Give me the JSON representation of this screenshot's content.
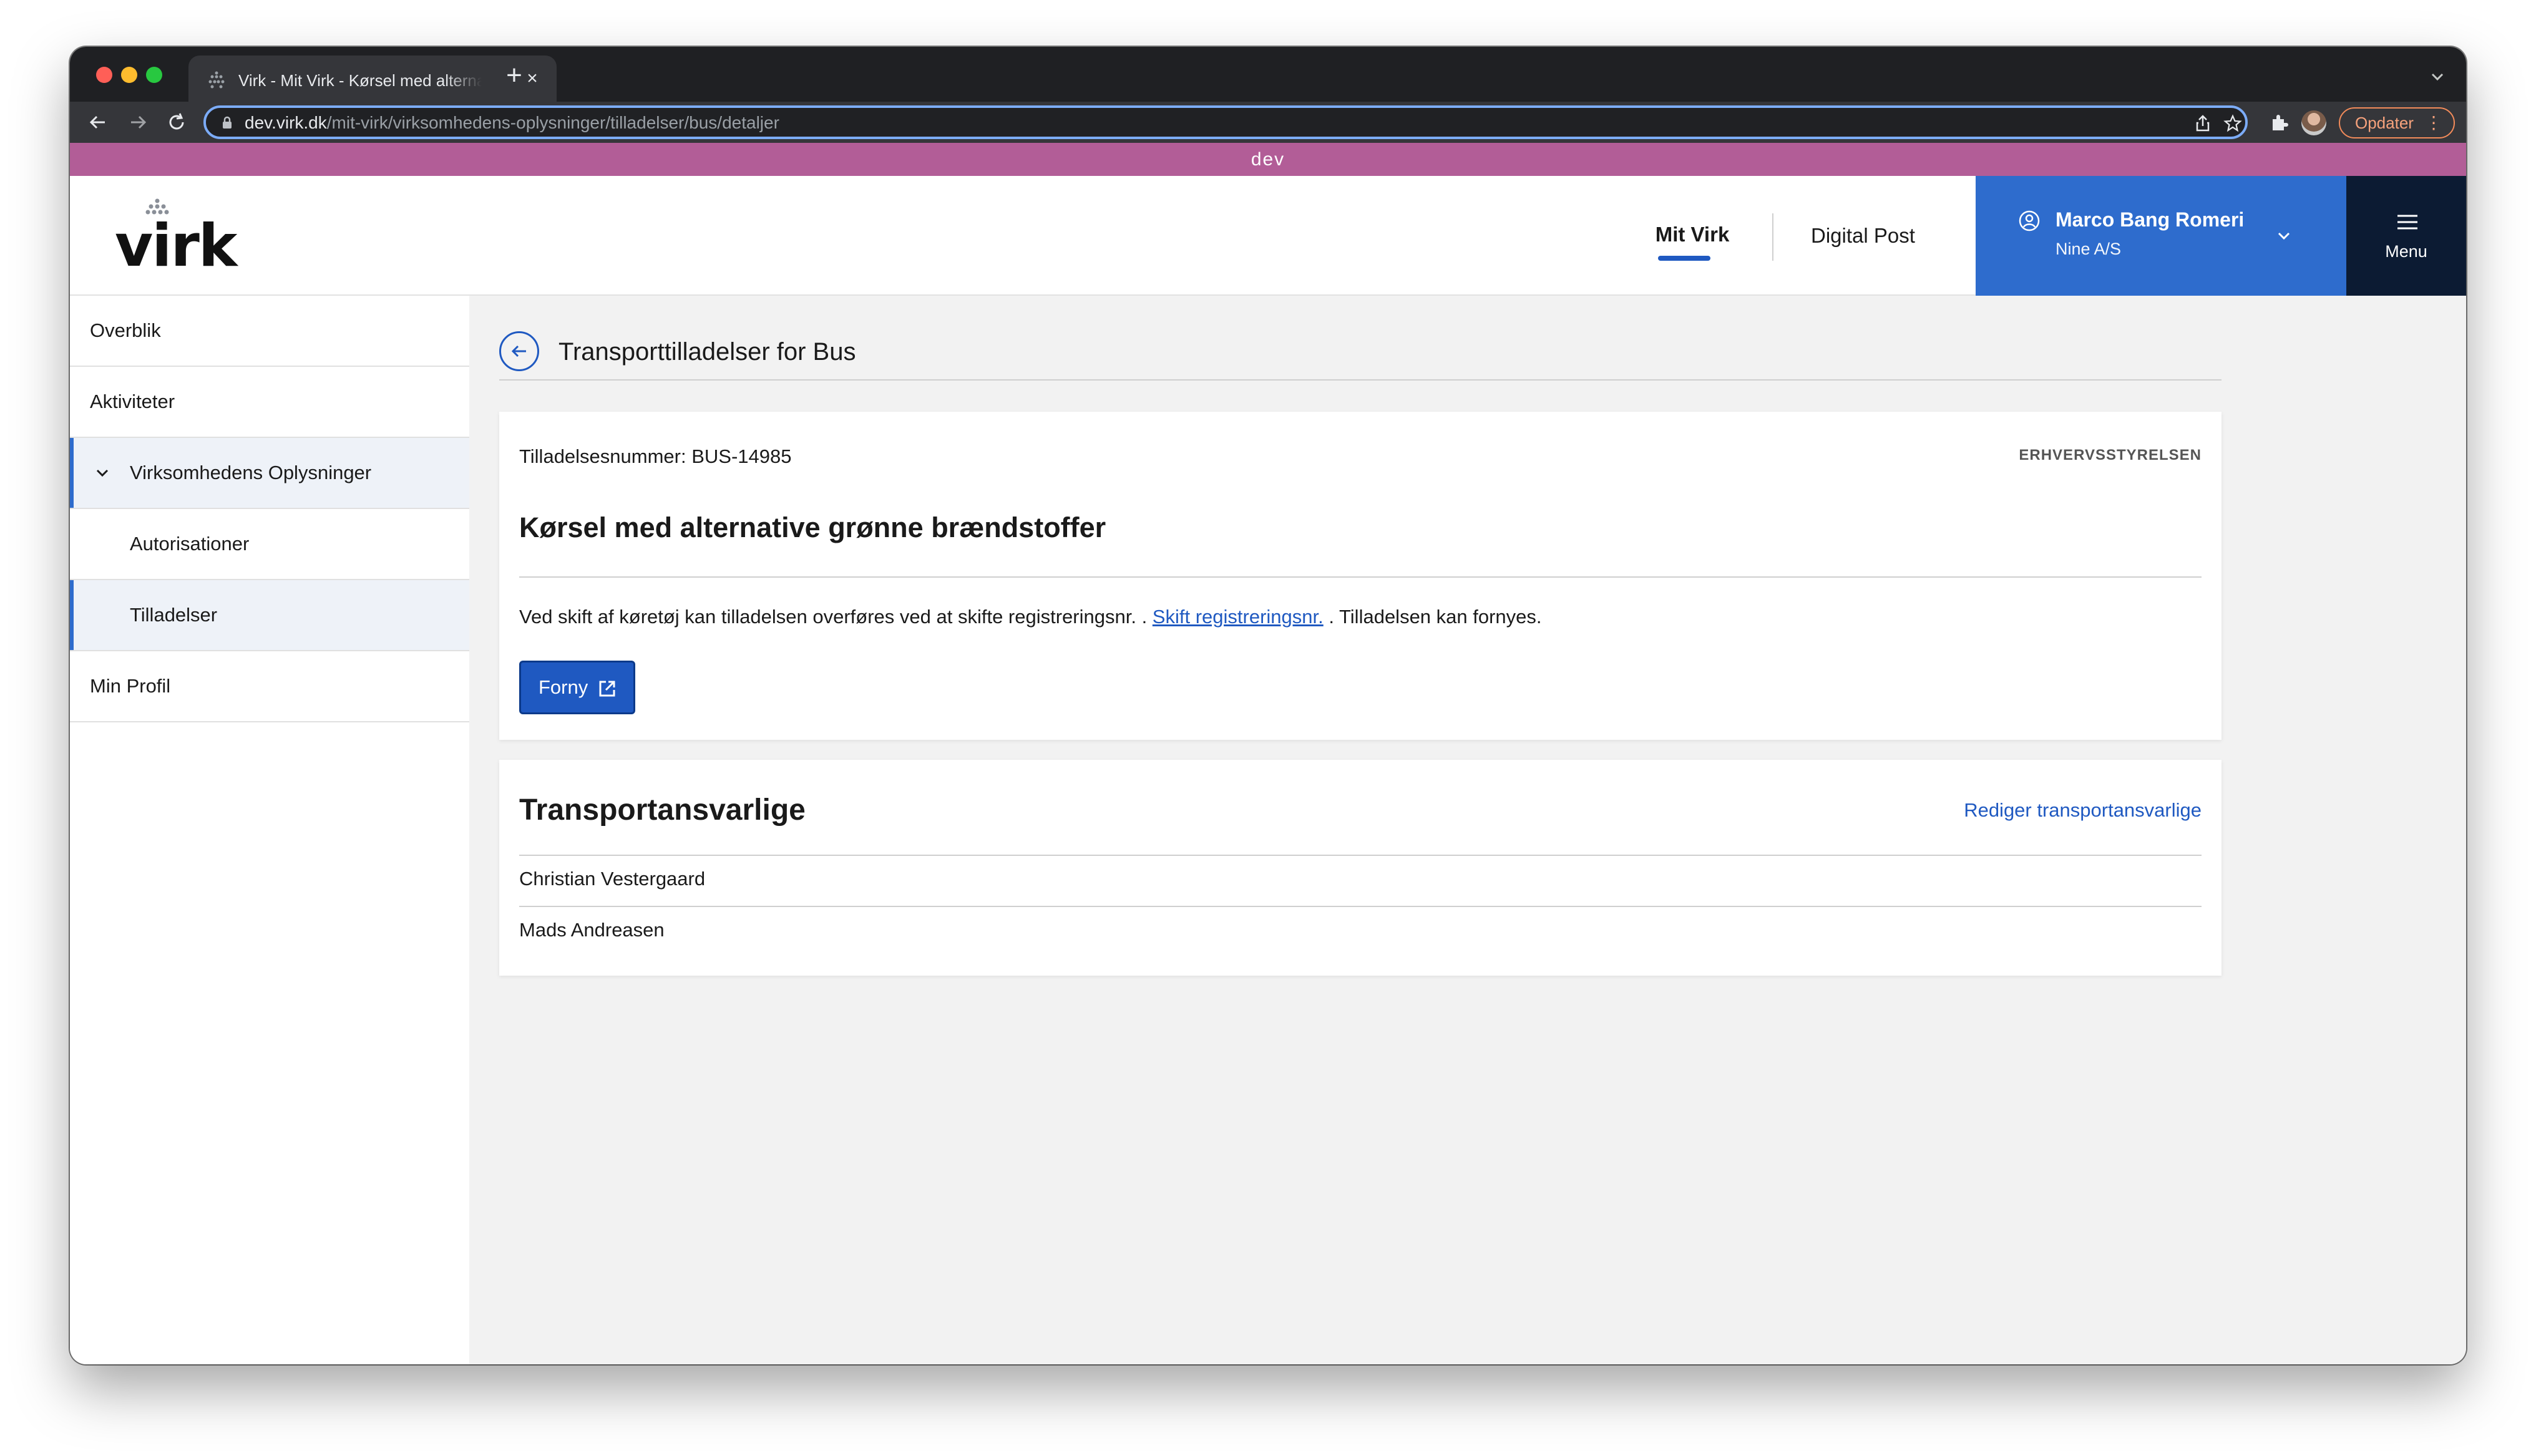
{
  "browser": {
    "tab_title": "Virk - Mit Virk - Kørsel med alternative grønne brændstoffer",
    "url_host": "dev.virk.dk",
    "url_path": "/mit-virk/virksomhedens-oplysninger/tilladelser/bus/detaljer",
    "update_label": "Opdater"
  },
  "env_banner": "dev",
  "header": {
    "logo_text": "virk",
    "nav": [
      {
        "label": "Mit Virk",
        "active": true
      },
      {
        "label": "Digital Post",
        "active": false
      }
    ],
    "user": {
      "name": "Marco Bang Romeri",
      "company": "Nine A/S"
    },
    "menu_label": "Menu"
  },
  "sidebar": {
    "items": [
      {
        "label": "Overblik"
      },
      {
        "label": "Aktiviteter"
      },
      {
        "label": "Virksomhedens Oplysninger",
        "expanded": true
      },
      {
        "label": "Autorisationer"
      },
      {
        "label": "Tilladelser",
        "active": true
      },
      {
        "label": "Min Profil"
      }
    ]
  },
  "main": {
    "page_title": "Transporttilladelser for Bus",
    "permit": {
      "number_label": "Tilladelsesnummer: BUS-14985",
      "authority": "ERHVERVSSTYRELSEN",
      "title": "Kørsel med alternative grønne brændstoffer",
      "desc_before": "Ved skift af køretøj kan tilladelsen overføres ved at skifte registreringsnr. . ",
      "desc_link": "Skift registreringsnr.",
      "desc_after": " . Tilladelsen kan fornyes.",
      "renew_label": "Forny"
    },
    "responsible": {
      "title": "Transportansvarlige",
      "edit_link": "Rediger transportansvarlige",
      "people": [
        "Christian Vestergaard",
        "Mads Andreasen"
      ]
    }
  },
  "colors": {
    "accent": "#1f59c1",
    "user_panel": "#2e6ccd",
    "menu_bg": "#0c1b33",
    "env_banner": "#b25d97"
  }
}
